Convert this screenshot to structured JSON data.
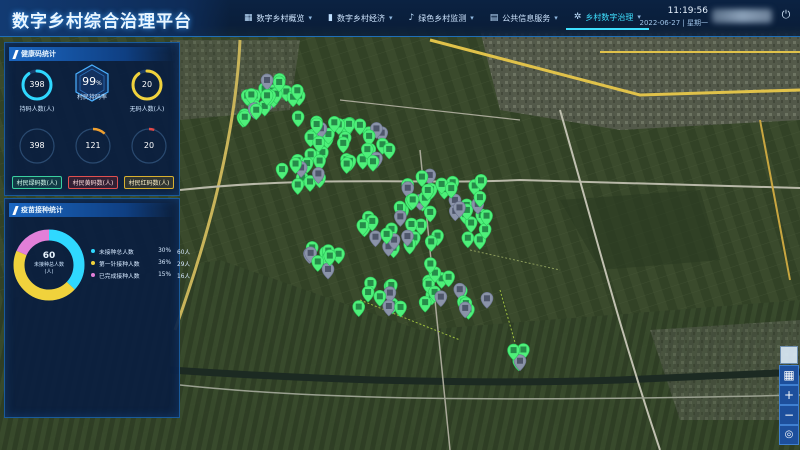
{
  "header": {
    "title": "数字乡村综合治理平台",
    "nav": [
      {
        "label": "数字乡村概览",
        "icon": "grid-icon"
      },
      {
        "label": "数字乡村经济",
        "icon": "bar-chart-icon"
      },
      {
        "label": "绿色乡村监测",
        "icon": "bell-icon"
      },
      {
        "label": "公共信息服务",
        "icon": "document-icon"
      },
      {
        "label": "乡村数字治理",
        "icon": "gear-icon"
      }
    ],
    "active_nav": 4,
    "time": "11:19:56",
    "date": "2022-06-27 | 星期一"
  },
  "health_panel": {
    "title": "健康码统计",
    "gauges_top": [
      {
        "value": "398",
        "label": "持码人数(人)",
        "color": "#2fd8ff",
        "fill": 0.9
      },
      {
        "value": "99",
        "unit": "%",
        "label": "村民持码率",
        "color": "#5ec8ff"
      },
      {
        "value": "20",
        "label": "无码人数(人)",
        "color": "#f0d23c",
        "fill": 0.9
      }
    ],
    "gauges_bottom": [
      {
        "value": "398",
        "label": "村民绿码数(人)",
        "tag": "green",
        "color": "#3ad0a0",
        "fill": 0.0
      },
      {
        "value": "121",
        "label": "村民黄码数(人)",
        "tag": "red",
        "color": "#f0a030",
        "fill": 0.12
      },
      {
        "value": "20",
        "label": "村民红码数(人)",
        "tag": "yellow",
        "color": "#e04848",
        "fill": 0.05
      }
    ]
  },
  "vaccine_panel": {
    "title": "疫苗接种统计",
    "center_value": "60",
    "center_label": "未接种总人数",
    "center_unit": "(人)",
    "legend": [
      {
        "name": "未接种总人数",
        "pct": "30%",
        "count": "60人",
        "color": "#2fd8ff",
        "share": 0.3
      },
      {
        "name": "第一针接种人数",
        "pct": "36%",
        "count": "29人",
        "color": "#f0d23c",
        "share": 0.36
      },
      {
        "name": "已完成接种人数",
        "pct": "15%",
        "count": "16人",
        "color": "#e27fd8",
        "share": 0.15
      }
    ]
  },
  "map_controls": [
    "layers-icon",
    "zoom-in-icon",
    "zoom-out-icon",
    "locate-icon"
  ]
}
